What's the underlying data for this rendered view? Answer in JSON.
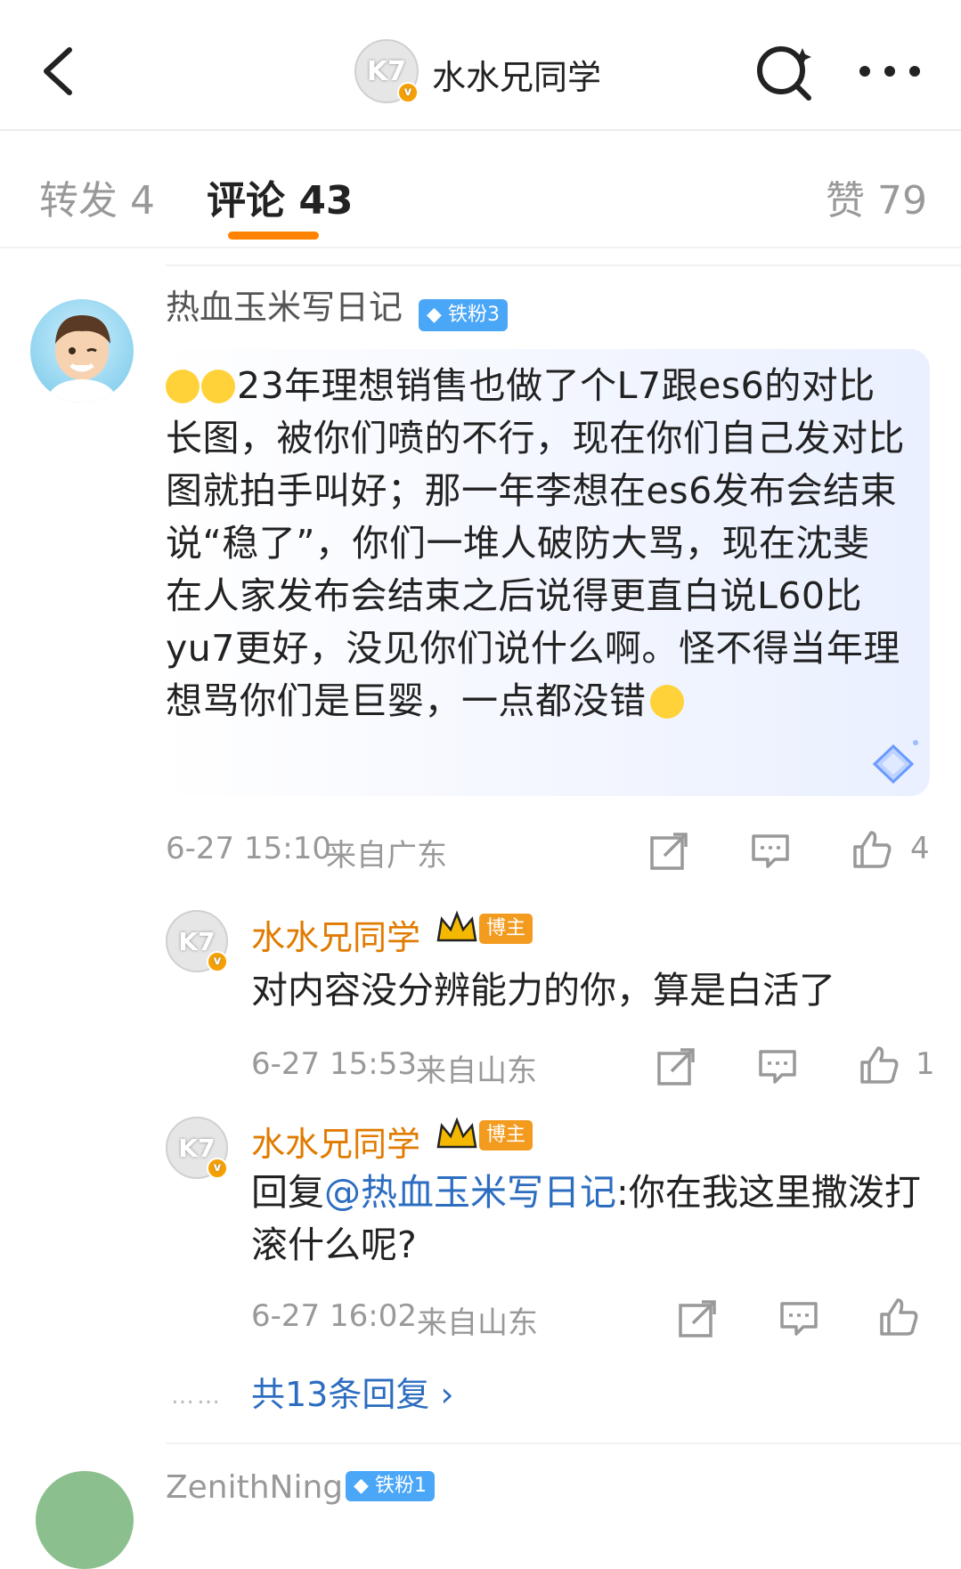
{
  "header": {
    "title": "水水兄同学",
    "avatar_text": "K7",
    "verified_icon": "v"
  },
  "tabs": {
    "repost": "转发 4",
    "comment": "评论 43",
    "like": "赞 79"
  },
  "comment": {
    "user": "热血玉米写日记",
    "fan_badge": "◆ 铁粉3",
    "text": "23年理想销售也做了个L7跟es6的对比长图，被你们喷的不行，现在你们自己发对比图就拍手叫好；那一年李想在es6发布会结束说“稳了”，你们一堆人破防大骂，现在沈斐在人家发布会结束之后说得更直白说L60比yu7更好，没见你们说什么啊。怪不得当年理想骂你们是巨婴，一点都没错",
    "time": "6-27 15:10",
    "location": "来自广东",
    "like_count": "4"
  },
  "replies": [
    {
      "user": "水水兄同学",
      "host_badge": "博主",
      "avatar_text": "K7",
      "text": "对内容没分辨能力的你，算是白活了",
      "time": "6-27 15:53",
      "location": "来自山东",
      "like_count": "1"
    },
    {
      "user": "水水兄同学",
      "host_badge": "博主",
      "avatar_text": "K7",
      "prefix": "回复",
      "mention": "@热血玉米写日记",
      "text": ":你在我这里撒泼打滚什么呢?",
      "time": "6-27 16:02",
      "location": "来自山东",
      "like_count": ""
    }
  ],
  "more": {
    "dots": "……",
    "label": "共13条回复 ›"
  },
  "next_comment": {
    "user": "ZenithNing",
    "fan_badge": "◆ 铁粉1"
  },
  "colors": {
    "accent": "#ff8200",
    "link": "#2c6dc0",
    "host_name": "#e07b00"
  }
}
